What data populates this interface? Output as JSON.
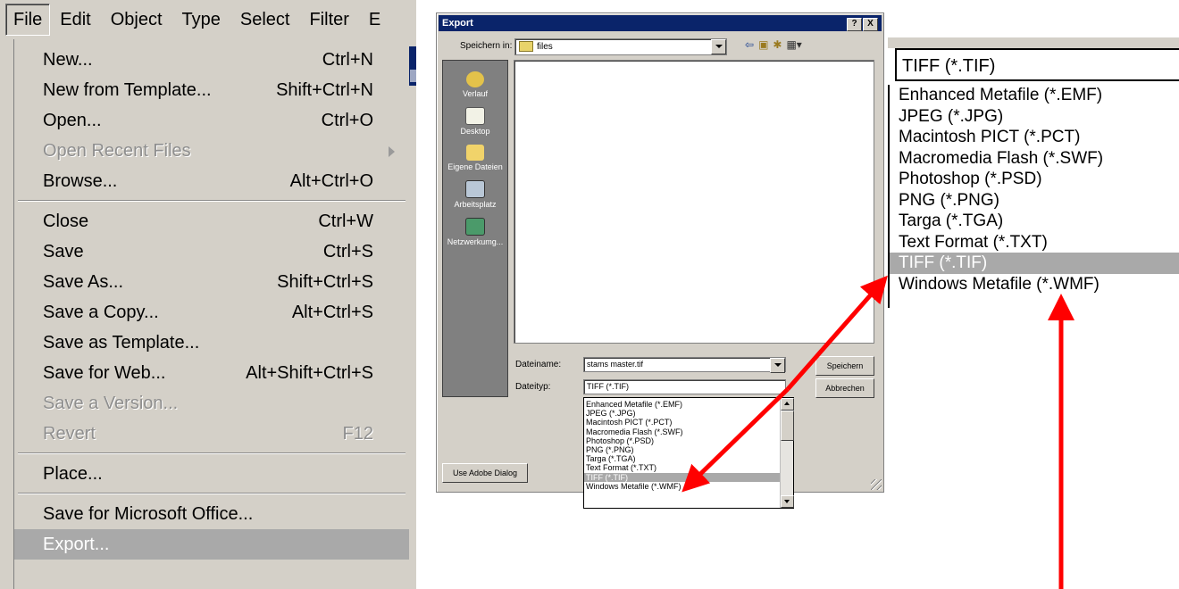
{
  "menubar": {
    "items": [
      "File",
      "Edit",
      "Object",
      "Type",
      "Select",
      "Filter",
      "E"
    ]
  },
  "file_menu": {
    "groups": [
      [
        {
          "label": "New...",
          "shortcut": "Ctrl+N",
          "state": "enabled"
        },
        {
          "label": "New from Template...",
          "shortcut": "Shift+Ctrl+N",
          "state": "enabled"
        },
        {
          "label": "Open...",
          "shortcut": "Ctrl+O",
          "state": "enabled"
        },
        {
          "label": "Open Recent Files",
          "shortcut": "",
          "state": "disabled",
          "submenu": true
        },
        {
          "label": "Browse...",
          "shortcut": "Alt+Ctrl+O",
          "state": "enabled"
        }
      ],
      [
        {
          "label": "Close",
          "shortcut": "Ctrl+W",
          "state": "enabled"
        },
        {
          "label": "Save",
          "shortcut": "Ctrl+S",
          "state": "enabled"
        },
        {
          "label": "Save As...",
          "shortcut": "Shift+Ctrl+S",
          "state": "enabled"
        },
        {
          "label": "Save a Copy...",
          "shortcut": "Alt+Ctrl+S",
          "state": "enabled"
        },
        {
          "label": "Save as Template...",
          "shortcut": "",
          "state": "enabled"
        },
        {
          "label": "Save for Web...",
          "shortcut": "Alt+Shift+Ctrl+S",
          "state": "enabled"
        },
        {
          "label": "Save a Version...",
          "shortcut": "",
          "state": "disabled"
        },
        {
          "label": "Revert",
          "shortcut": "F12",
          "state": "disabled"
        }
      ],
      [
        {
          "label": "Place...",
          "shortcut": "",
          "state": "enabled"
        }
      ],
      [
        {
          "label": "Save for Microsoft Office...",
          "shortcut": "",
          "state": "enabled"
        },
        {
          "label": "Export...",
          "shortcut": "",
          "state": "highlight"
        }
      ]
    ]
  },
  "dialog": {
    "title": "Export",
    "help_button": "?",
    "close_button": "X",
    "look_in_label": "Speichern in:",
    "look_in_value": "files",
    "places": [
      "Verlauf",
      "Desktop",
      "Eigene Dateien",
      "Arbeitsplatz",
      "Netzwerkumg..."
    ],
    "file_name_label": "Dateiname:",
    "file_name_value": "stams master.tif",
    "file_type_label": "Dateityp:",
    "file_type_value": "TIFF (*.TIF)",
    "save_button": "Speichern",
    "cancel_button": "Abbrechen",
    "adobe_dialog_button": "Use Adobe Dialog",
    "file_types": [
      "Enhanced Metafile (*.EMF)",
      "JPEG (*.JPG)",
      "Macintosh PICT (*.PCT)",
      "Macromedia Flash (*.SWF)",
      "Photoshop (*.PSD)",
      "PNG (*.PNG)",
      "Targa (*.TGA)",
      "Text Format (*.TXT)",
      "TIFF (*.TIF)",
      "Windows Metafile (*.WMF)"
    ],
    "selected_type_index": 8
  },
  "zoom": {
    "combo_value": "TIFF (*.TIF)",
    "options": [
      "Enhanced Metafile (*.EMF)",
      "JPEG (*.JPG)",
      "Macintosh PICT (*.PCT)",
      "Macromedia Flash (*.SWF)",
      "Photoshop (*.PSD)",
      "PNG (*.PNG)",
      "Targa (*.TGA)",
      "Text Format (*.TXT)",
      "TIFF (*.TIF)",
      "Windows Metafile (*.WMF)"
    ],
    "selected_index": 8
  },
  "colors": {
    "menu_bg": "#d4d0c8",
    "highlight": "#a9a9a9",
    "title_bar": "#0a246a",
    "arrow": "#ff0000"
  },
  "icons": {
    "up-folder": "up-folder-icon",
    "new-folder": "new-folder-icon",
    "view-menu": "view-menu-icon",
    "back": "back-icon"
  }
}
